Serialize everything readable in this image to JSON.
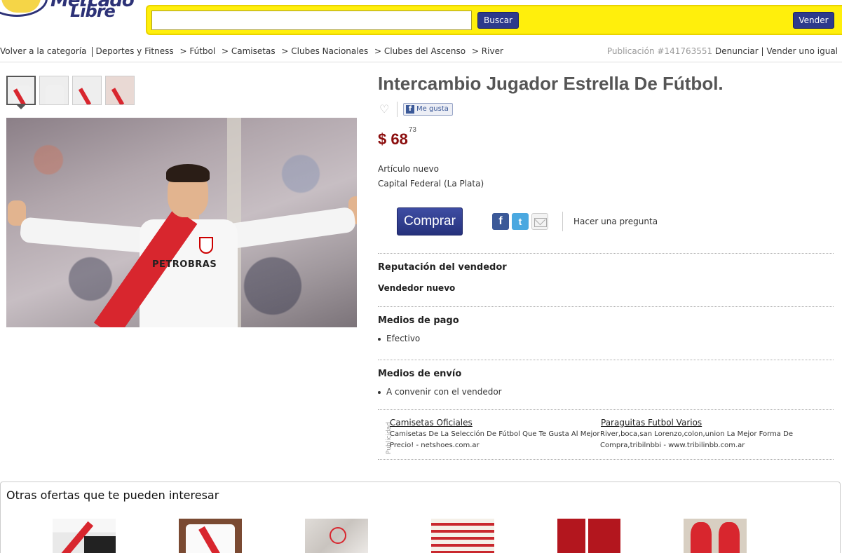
{
  "header": {
    "logo_text_line1": "Mercado",
    "logo_text_line2": "Libre",
    "search": {
      "value": "",
      "placeholder": ""
    },
    "search_button": "Buscar",
    "sell_button": "Vender"
  },
  "breadcrumb": {
    "back": "Volver a la categoría",
    "items": [
      "Deportes y Fitness",
      "> Fútbol",
      "> Camisetas",
      "> Clubes Nacionales",
      "> Clubes del Ascenso",
      "> River"
    ]
  },
  "publication": {
    "number": "Publicación #141763551",
    "report": "Denunciar",
    "sell_same": "Vender uno igual",
    "separator": "|"
  },
  "product": {
    "title": "Intercambio Jugador Estrella De Fútbol.",
    "like_label": "Me gusta",
    "price_currency": "$",
    "price_integer": "68",
    "price_cents": "73",
    "condition": "Artículo nuevo",
    "location": "Capital Federal (La Plata)",
    "buy_button": "Comprar",
    "ask_link": "Hacer una pregunta",
    "image_text": "PETROBRAS"
  },
  "icons": {
    "heart": "heart-icon",
    "facebook": "facebook-icon",
    "twitter": "twitter-icon",
    "mail": "mail-icon",
    "facebook_glyph": "f",
    "twitter_glyph": "t"
  },
  "seller": {
    "reputation_heading": "Reputación del vendedor",
    "reputation_value": "Vendedor nuevo"
  },
  "payment": {
    "heading": "Medios de pago",
    "methods": [
      "Efectivo"
    ]
  },
  "shipping": {
    "heading": "Medios de envío",
    "methods": [
      "A convenir con el vendedor"
    ]
  },
  "ads": {
    "label": "Publicidad",
    "items": [
      {
        "title": "Camisetas Oficiales",
        "text": "Camisetas De La Selección De Fútbol Que Te Gusta Al Mejor Precio! - netshoes.com.ar"
      },
      {
        "title": "Paraguitas Futbol Varios",
        "text": "River,boca,san Lorenzo,colon,union La Mejor Forma De Compra,tribilnbbi - www.tribilinbb.com.ar"
      }
    ]
  },
  "other_offers": {
    "heading": "Otras ofertas que te pueden interesar"
  },
  "colors": {
    "brand_yellow": "#ffef0c",
    "brand_blue": "#2d3a8c",
    "price_red": "#8b0d0d"
  }
}
